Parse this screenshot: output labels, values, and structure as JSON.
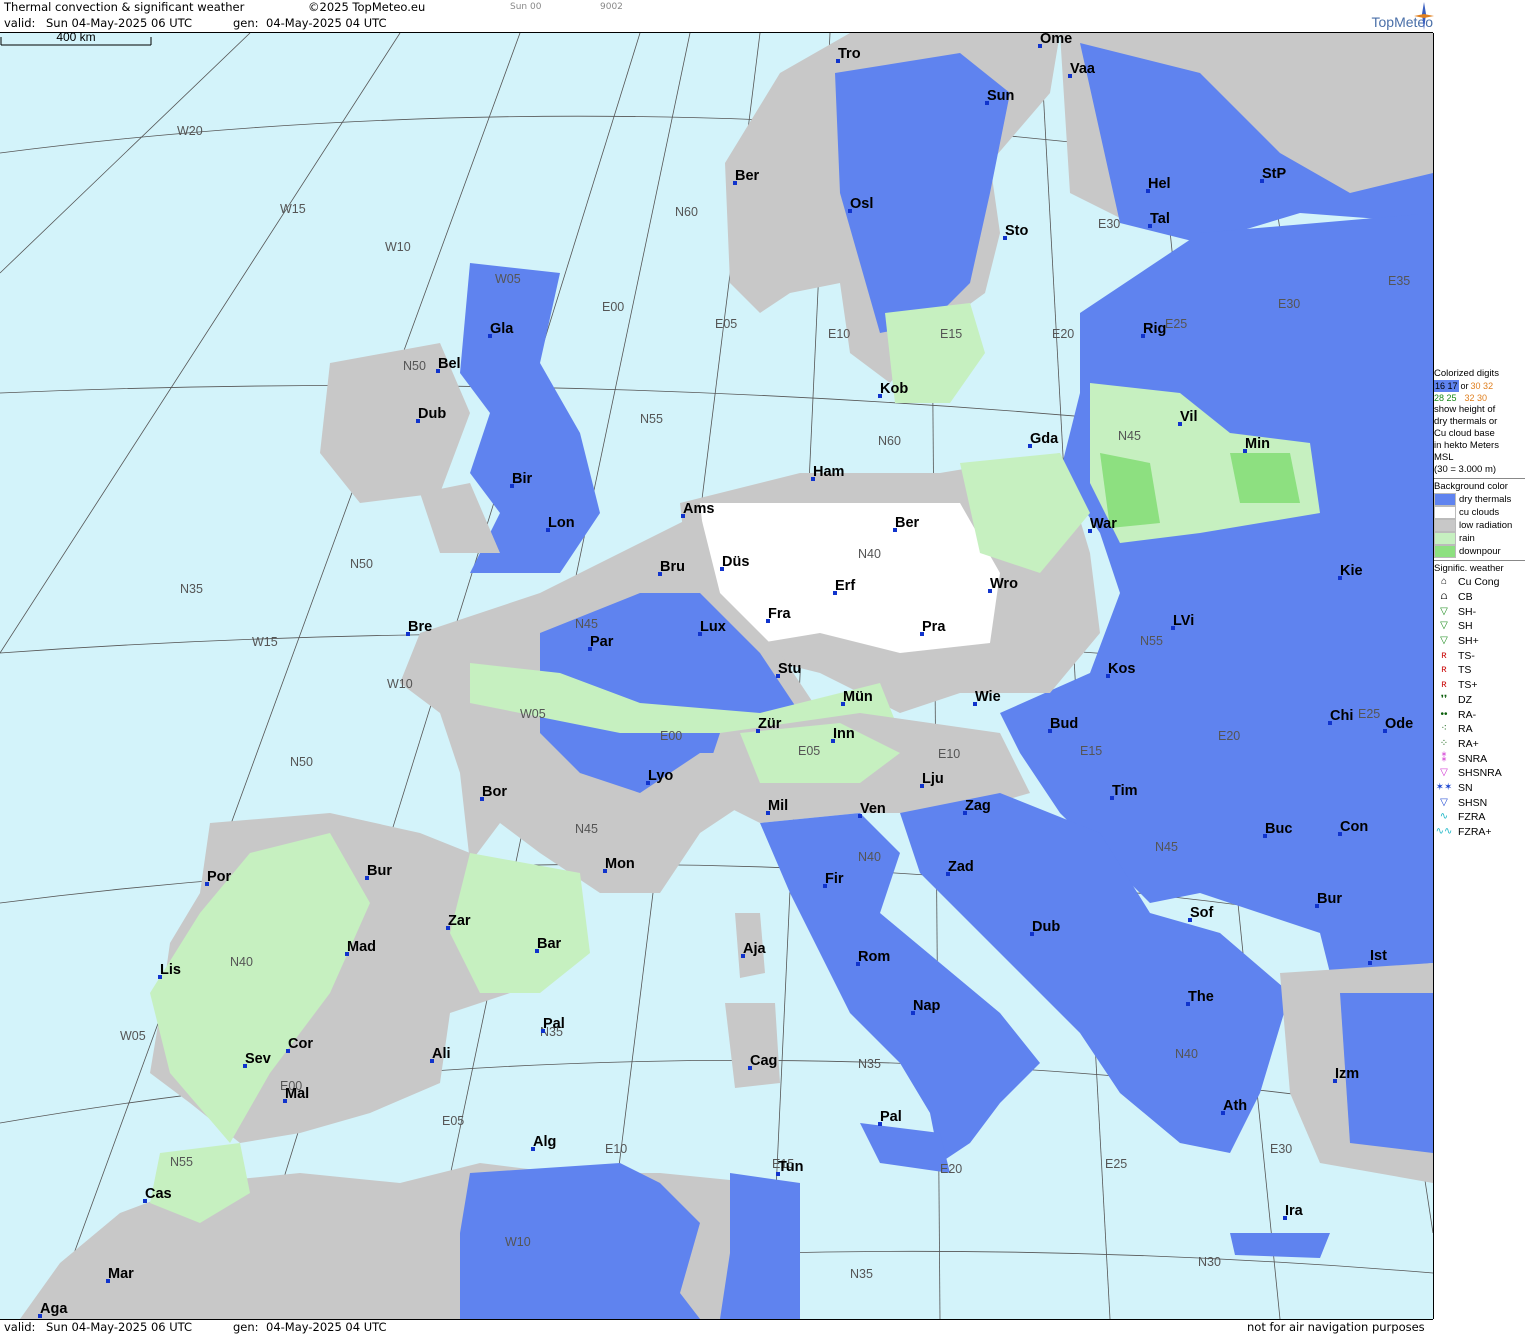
{
  "header": {
    "title": "Thermal convection & significant weather",
    "copyright": "©2025 TopMeteo.eu",
    "run_label": "Sun 00",
    "run_code": "9002",
    "valid_label": "valid:",
    "valid_value": "Sun  04-May-2025  06 UTC",
    "gen_label": "gen:",
    "gen_value": "04-May-2025 04 UTC",
    "brand": "TopMeteo"
  },
  "footer": {
    "valid_label": "valid:",
    "valid_value": "Sun  04-May-2025  06 UTC",
    "gen_label": "gen:",
    "gen_value": "04-May-2025 04 UTC",
    "disclaimer": "not for air navigation purposes"
  },
  "scale_bar": {
    "label": "400 km"
  },
  "cities": [
    "Tro",
    "Ome",
    "Vaa",
    "Sun",
    "Ber",
    "Osl",
    "Sto",
    "Hel",
    "StP",
    "Tal",
    "Rig",
    "Gla",
    "Bel",
    "Dub",
    "Kob",
    "Gda",
    "Vil",
    "Min",
    "Ham",
    "Bir",
    "Lon",
    "Ams",
    "Ber",
    "War",
    "Düs",
    "Bru",
    "Erf",
    "Wro",
    "Kie",
    "Bre",
    "Fra",
    "Pra",
    "Lux",
    "LVi",
    "Par",
    "Stu",
    "Kos",
    "Mün",
    "Wie",
    "Chi",
    "Ode",
    "Zür",
    "Inn",
    "Bud",
    "Lyo",
    "Lju",
    "Bor",
    "Mil",
    "Ven",
    "Zag",
    "Tim",
    "Buc",
    "Con",
    "Mon",
    "Por",
    "Bur",
    "Zad",
    "Fir",
    "Zar",
    "Bar",
    "Mad",
    "Aja",
    "Rom",
    "Dub",
    "Sof",
    "Bur",
    "Ist",
    "Lis",
    "Nap",
    "The",
    "Pal",
    "Cag",
    "Sev",
    "Cor",
    "Ali",
    "Izm",
    "Mal",
    "Ath",
    "Pal",
    "Alg",
    "Tun",
    "Cas",
    "Ira",
    "Mar",
    "Aga"
  ],
  "grid_labels": [
    "W20",
    "W15",
    "W10",
    "W05",
    "E00",
    "E05",
    "E10",
    "E15",
    "E20",
    "E25",
    "E30",
    "E35",
    "N60",
    "N55",
    "N50",
    "N45",
    "N40",
    "N35",
    "W15",
    "W10",
    "W05",
    "E00",
    "E05",
    "E10",
    "E15",
    "E20",
    "E25",
    "E30",
    "N60",
    "N55",
    "N50",
    "N45",
    "N40",
    "N35",
    "N55",
    "N50",
    "N45",
    "N40",
    "N35",
    "W10",
    "W05",
    "E00",
    "E05",
    "E10",
    "E15",
    "E20",
    "E25",
    "E30",
    "N45",
    "N40",
    "N35",
    "N30"
  ],
  "legend": {
    "colorized_title": "Colorized digits",
    "colorized_sample_1": "16 17",
    "colorized_or": "or",
    "colorized_sample_2": "30 32",
    "colorized_sample_3": "28 25",
    "colorized_sample_4": "32 30",
    "colorized_desc": [
      "show height of",
      "dry thermals or",
      "Cu cloud base",
      "in hekto Meters",
      "MSL",
      "(30 = 3.000 m)"
    ],
    "background_title": "Background color",
    "background": [
      {
        "label": "dry thermals",
        "color": "#5f83ef"
      },
      {
        "label": "cu clouds",
        "color": "#ffffff"
      },
      {
        "label": "low radiation",
        "color": "#c8c8c8"
      },
      {
        "label": "rain",
        "color": "#c6f0c0"
      },
      {
        "label": "downpour",
        "color": "#8de080"
      }
    ],
    "weather_title": "Signific. weather",
    "weather": [
      {
        "label": "Cu Cong",
        "icon": "cu-cong-icon",
        "symbol": "⌂",
        "color": "#000000"
      },
      {
        "label": "CB",
        "icon": "cb-icon",
        "symbol": "⩍",
        "color": "#000000"
      },
      {
        "label": "SH-",
        "icon": "shower-light-icon",
        "symbol": "▽",
        "color": "#1a8a1a"
      },
      {
        "label": "SH",
        "icon": "shower-icon",
        "symbol": "▽",
        "color": "#1a8a1a"
      },
      {
        "label": "SH+",
        "icon": "shower-heavy-icon",
        "symbol": "▽",
        "color": "#1a8a1a"
      },
      {
        "label": "TS-",
        "icon": "thunderstorm-light-icon",
        "symbol": "ʀ",
        "color": "#cc1111"
      },
      {
        "label": "TS",
        "icon": "thunderstorm-icon",
        "symbol": "ʀ",
        "color": "#cc1111"
      },
      {
        "label": "TS+",
        "icon": "thunderstorm-heavy-icon",
        "symbol": "ʀ",
        "color": "#cc1111"
      },
      {
        "label": "DZ",
        "icon": "drizzle-icon",
        "symbol": "❜❜",
        "color": "#0b5e0b"
      },
      {
        "label": "RA-",
        "icon": "rain-light-icon",
        "symbol": "••",
        "color": "#0b5e0b"
      },
      {
        "label": "RA",
        "icon": "rain-icon",
        "symbol": "⁖",
        "color": "#0b5e0b"
      },
      {
        "label": "RA+",
        "icon": "rain-heavy-icon",
        "symbol": "⁘",
        "color": "#0b5e0b"
      },
      {
        "label": "SNRA",
        "icon": "snow-rain-icon",
        "symbol": "⁑",
        "color": "#d030d0"
      },
      {
        "label": "SHSNRA",
        "icon": "snow-rain-shower-icon",
        "symbol": "▽",
        "color": "#d030d0"
      },
      {
        "label": "SN",
        "icon": "snow-icon",
        "symbol": "✶✶",
        "color": "#1a44d0"
      },
      {
        "label": "SHSN",
        "icon": "snow-shower-icon",
        "symbol": "▽",
        "color": "#1a44d0"
      },
      {
        "label": "FZRA",
        "icon": "freezing-rain-icon",
        "symbol": "∿",
        "color": "#20b8c8"
      },
      {
        "label": "FZRA+",
        "icon": "freezing-rain-heavy-icon",
        "symbol": "∿∿",
        "color": "#20b8c8"
      }
    ]
  },
  "colors": {
    "sea": "#d3f3fa",
    "dry_thermals": "#5f83ef",
    "low_radiation": "#c8c8c8",
    "rain": "#c6f0c0",
    "downpour": "#8de080",
    "cu_clouds": "#ffffff"
  }
}
